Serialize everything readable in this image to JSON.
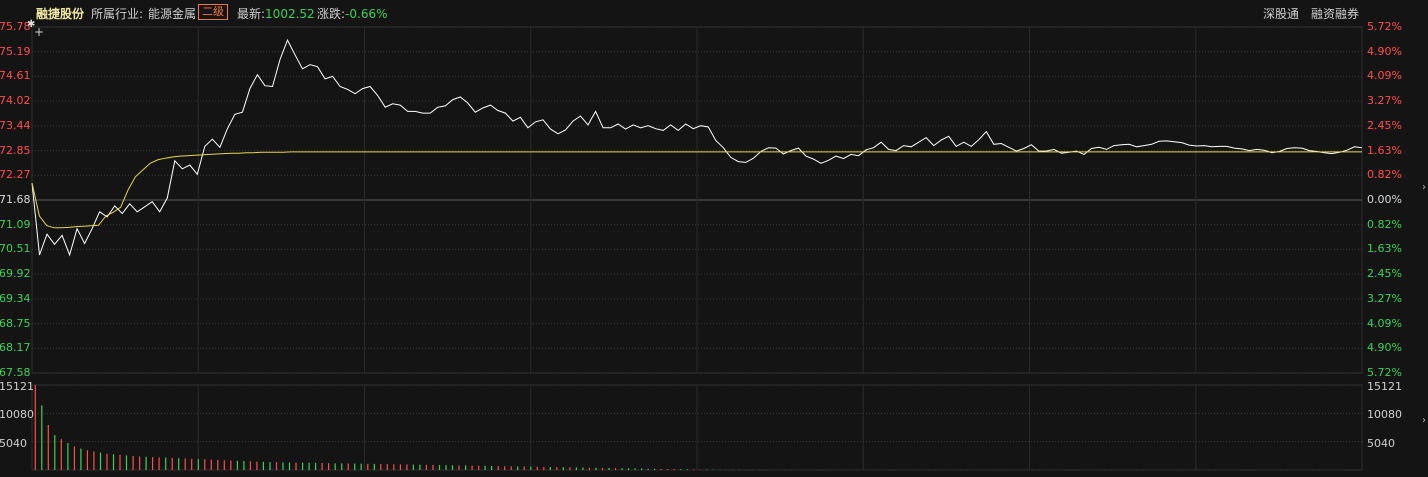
{
  "header": {
    "stock_name": "融捷股份",
    "industry_label": "所属行业:",
    "industry_name": "能源金属",
    "level_badge": "二级",
    "latest_label": "最新:",
    "latest_value": "1002.52",
    "change_label": "涨跌:",
    "change_value": "-0.66%",
    "links": [
      "深股通",
      "融资融券"
    ]
  },
  "colors": {
    "background": "#141414",
    "price_line": "#ffffff",
    "avg_line": "#e6d84a",
    "up": "#ff4d4d",
    "down": "#39d353",
    "grid": "#3a3a3a"
  },
  "price_axis": {
    "left": [
      "75.78",
      "75.19",
      "74.61",
      "74.02",
      "73.44",
      "72.85",
      "72.27",
      "71.68",
      "71.09",
      "70.51",
      "69.92",
      "69.34",
      "68.75",
      "68.17",
      "67.58"
    ],
    "right": [
      "5.72%",
      "4.90%",
      "4.09%",
      "3.27%",
      "2.45%",
      "1.63%",
      "0.82%",
      "0.00%",
      "0.82%",
      "1.63%",
      "2.45%",
      "3.27%",
      "4.09%",
      "4.90%",
      "5.72%"
    ],
    "reference": 71.68
  },
  "volume_axis": {
    "left": [
      "15121",
      "10080",
      "5040"
    ],
    "right": [
      "15121",
      "10080",
      "5040"
    ],
    "max": 15121
  },
  "chart_data": {
    "type": "line",
    "ylim": [
      67.58,
      75.78
    ],
    "series": [
      {
        "values": [
          72.08,
          70.38,
          70.87,
          70.63,
          70.84,
          70.38,
          71.0,
          70.65,
          71.0,
          71.4,
          71.28,
          71.54,
          71.36,
          71.59,
          71.4,
          71.52,
          71.64,
          71.4,
          71.73,
          72.61,
          72.42,
          72.51,
          72.29,
          72.95,
          73.12,
          72.93,
          73.37,
          73.71,
          73.76,
          74.32,
          74.65,
          74.39,
          74.37,
          75.01,
          75.47,
          75.12,
          74.79,
          74.89,
          74.84,
          74.55,
          74.61,
          74.37,
          74.3,
          74.2,
          74.32,
          74.37,
          74.16,
          73.88,
          73.96,
          73.93,
          73.78,
          73.78,
          73.74,
          73.74,
          73.88,
          73.91,
          74.06,
          74.12,
          73.98,
          73.76,
          73.86,
          73.93,
          73.8,
          73.74,
          73.55,
          73.64,
          73.39,
          73.53,
          73.58,
          73.36,
          73.25,
          73.34,
          73.55,
          73.67,
          73.46,
          73.78,
          73.39,
          73.39,
          73.48,
          73.36,
          73.46,
          73.39,
          73.44,
          73.37,
          73.33,
          73.46,
          73.33,
          73.48,
          73.37,
          73.44,
          73.41,
          73.09,
          72.92,
          72.69,
          72.59,
          72.57,
          72.67,
          72.83,
          72.92,
          72.91,
          72.77,
          72.85,
          72.91,
          72.72,
          72.65,
          72.55,
          72.62,
          72.72,
          72.66,
          72.76,
          72.73,
          72.87,
          72.92,
          73.05,
          72.88,
          72.85,
          72.97,
          72.94,
          73.05,
          73.16,
          72.97,
          73.1,
          73.19,
          72.95,
          73.05,
          72.95,
          73.11,
          73.3,
          73.0,
          73.02,
          72.93,
          72.84,
          72.9,
          72.99,
          72.84,
          72.84,
          72.88,
          72.79,
          72.81,
          72.84,
          72.76,
          72.9,
          72.93,
          72.88,
          72.97,
          72.99,
          73.0,
          72.94,
          72.97,
          73.0,
          73.07,
          73.08,
          73.06,
          73.04,
          72.98,
          72.96,
          72.97,
          72.94,
          72.95,
          72.95,
          72.91,
          72.89,
          72.85,
          72.88,
          72.86,
          72.8,
          72.83,
          72.9,
          72.92,
          72.91,
          72.85,
          72.83,
          72.8,
          72.78,
          72.81,
          72.86,
          72.94,
          72.92
        ]
      },
      {
        "values": [
          72.08,
          71.3,
          71.07,
          71.02,
          71.02,
          71.03,
          71.05,
          71.06,
          71.07,
          71.08,
          71.3,
          71.39,
          71.51,
          71.92,
          72.23,
          72.39,
          72.55,
          72.63,
          72.67,
          72.7,
          72.72,
          72.73,
          72.74,
          72.75,
          72.76,
          72.77,
          72.78,
          72.79,
          72.79,
          72.8,
          72.8,
          72.81,
          72.81,
          72.81,
          72.81,
          72.82,
          72.82,
          72.82,
          72.82,
          72.82,
          72.82,
          72.82,
          72.82,
          72.82,
          72.82,
          72.82,
          72.82,
          72.82,
          72.82,
          72.82,
          72.82,
          72.82,
          72.82,
          72.82,
          72.82,
          72.82,
          72.82,
          72.82,
          72.82,
          72.82,
          72.82,
          72.82,
          72.82,
          72.82,
          72.82,
          72.82,
          72.82,
          72.82,
          72.82,
          72.82,
          72.82,
          72.82,
          72.82,
          72.82,
          72.82,
          72.82,
          72.82,
          72.82,
          72.82,
          72.82,
          72.82,
          72.82,
          72.82,
          72.82,
          72.82,
          72.82,
          72.82,
          72.82,
          72.82,
          72.82,
          72.82,
          72.82,
          72.82,
          72.82,
          72.82,
          72.82,
          72.82,
          72.82,
          72.82,
          72.82,
          72.82,
          72.82,
          72.82,
          72.82,
          72.82,
          72.82,
          72.82,
          72.82,
          72.82,
          72.82,
          72.82,
          72.82,
          72.82,
          72.82,
          72.82,
          72.82,
          72.82,
          72.82,
          72.82,
          72.82,
          72.82,
          72.82,
          72.82,
          72.82,
          72.82,
          72.82,
          72.82,
          72.82,
          72.82,
          72.82,
          72.82,
          72.82,
          72.82,
          72.82,
          72.82,
          72.82,
          72.82,
          72.82,
          72.82,
          72.82,
          72.82,
          72.82,
          72.82,
          72.82,
          72.82,
          72.82,
          72.82,
          72.82,
          72.82,
          72.82,
          72.82,
          72.82,
          72.82,
          72.82,
          72.82,
          72.82,
          72.82,
          72.82,
          72.82,
          72.82,
          72.82,
          72.82,
          72.82,
          72.82,
          72.82,
          72.82,
          72.82,
          72.82,
          72.82,
          72.82,
          72.82,
          72.82,
          72.82,
          72.82,
          72.82,
          72.82,
          72.82,
          72.82,
          72.82,
          72.82,
          72.82
        ]
      }
    ],
    "volume": [
      15121,
      11500,
      8000,
      6200,
      5500,
      4800,
      4200,
      3800,
      3500,
      3300,
      3100,
      2900,
      2800,
      2700,
      2600,
      2500,
      2400,
      2350,
      2300,
      2250,
      2200,
      2150,
      2100,
      2050,
      2000,
      1950,
      1900,
      1850,
      1800,
      1750,
      1700,
      1650,
      1600,
      1550,
      1500,
      1450,
      1400,
      1380,
      1360,
      1340,
      1320,
      1300,
      1280,
      1260,
      1240,
      1220,
      1200,
      1180,
      1160,
      1140,
      1120,
      1100,
      1080,
      1060,
      1040,
      1020,
      1000,
      980,
      960,
      940,
      920,
      900,
      880,
      860,
      840,
      820,
      800,
      780,
      760,
      740,
      720,
      700,
      680,
      660,
      640,
      620,
      600,
      580,
      560,
      540,
      520,
      500,
      480,
      460,
      440,
      420,
      400,
      380,
      360,
      340,
      320,
      300,
      280,
      260,
      240,
      220,
      200,
      180,
      160,
      140,
      120,
      100,
      90,
      80,
      70,
      60,
      55,
      50,
      45,
      40,
      35,
      30,
      28,
      26,
      24,
      22,
      20,
      18,
      16,
      14,
      12,
      10,
      10,
      10,
      10,
      10,
      10,
      10,
      10,
      10,
      10,
      10,
      10,
      10,
      10,
      10,
      10,
      10,
      10,
      10,
      10,
      10,
      10,
      10,
      10,
      10,
      10,
      10,
      10,
      10,
      10,
      10,
      10,
      10,
      10,
      10,
      10,
      10,
      10,
      10,
      10,
      10,
      10,
      10,
      10,
      10,
      10,
      10,
      10,
      10,
      10,
      10,
      10,
      10,
      10,
      10,
      10,
      10,
      10,
      10,
      10,
      10,
      10,
      10,
      10,
      10,
      10,
      10,
      10,
      10,
      10,
      10,
      10,
      10,
      10,
      10,
      10,
      10,
      10,
      10,
      10,
      10,
      10,
      10
    ]
  }
}
